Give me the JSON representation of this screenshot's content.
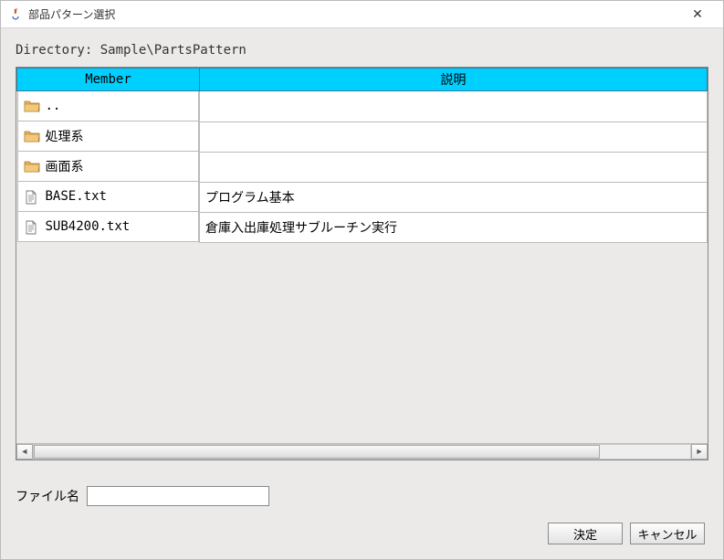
{
  "window": {
    "title": "部品パターン選択"
  },
  "directory_label": "Directory: Sample\\PartsPattern",
  "table": {
    "headers": {
      "member": "Member",
      "description": "説明"
    },
    "rows": [
      {
        "type": "folder",
        "name": "..",
        "description": ""
      },
      {
        "type": "folder",
        "name": "処理系",
        "description": ""
      },
      {
        "type": "folder",
        "name": "画面系",
        "description": ""
      },
      {
        "type": "file",
        "name": "BASE.txt",
        "description": "プログラム基本"
      },
      {
        "type": "file",
        "name": "SUB4200.txt",
        "description": "倉庫入出庫処理サブルーチン実行"
      }
    ]
  },
  "filename": {
    "label": "ファイル名",
    "value": ""
  },
  "buttons": {
    "ok": "決定",
    "cancel": "キャンセル"
  }
}
